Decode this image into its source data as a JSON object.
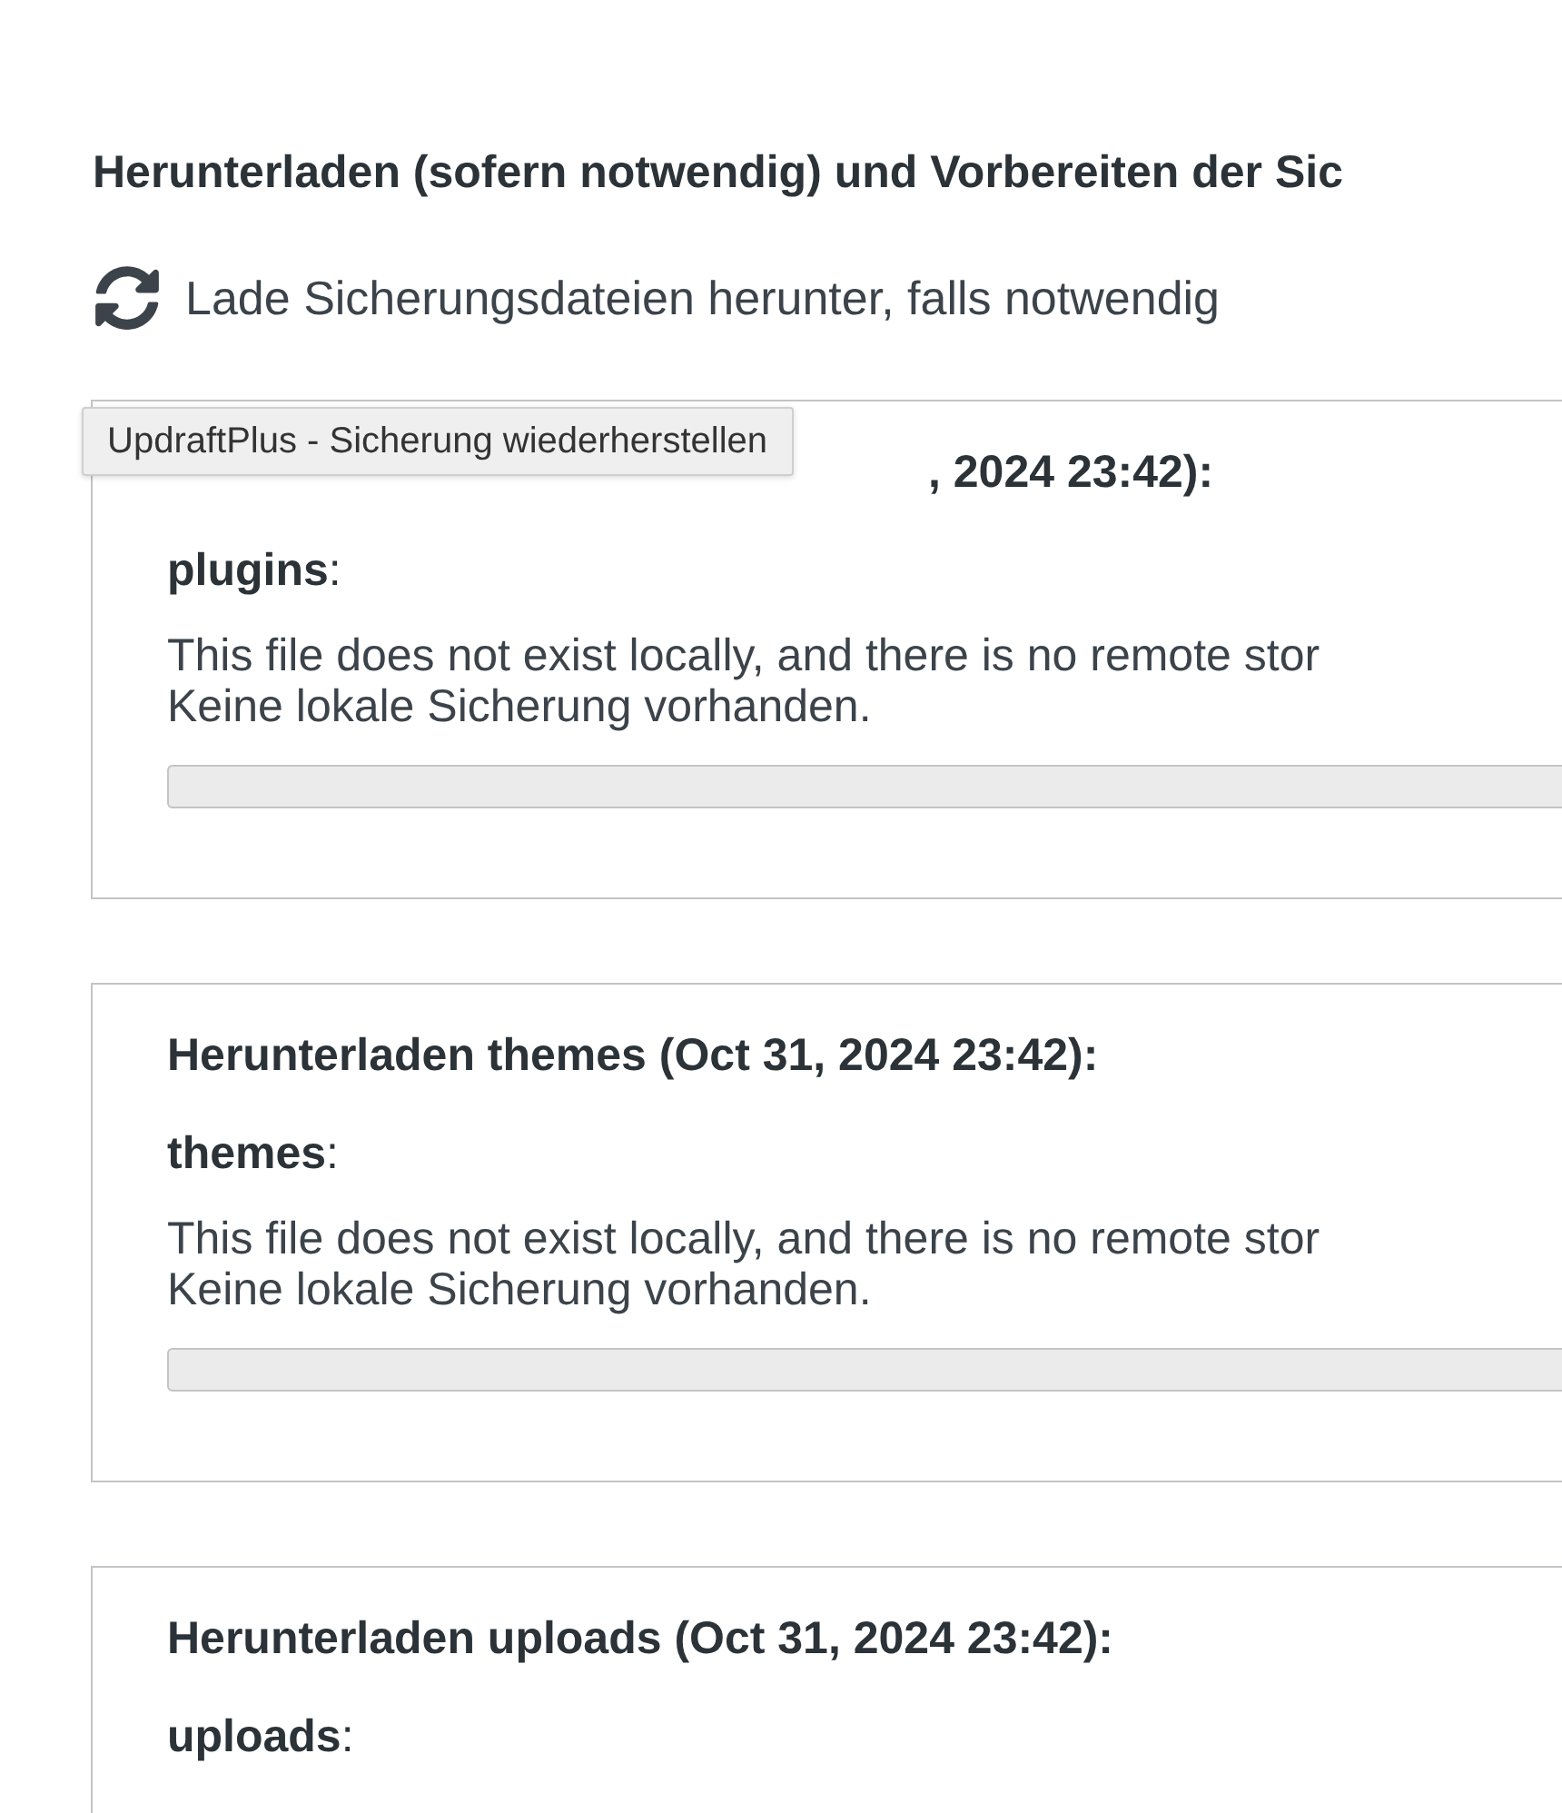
{
  "section_title": "Herunterladen (sofern notwendig) und Vorbereiten der Sic",
  "status": {
    "text": "Lade Sicherungsdateien herunter, falls notwendig"
  },
  "tooltip": {
    "text": "UpdraftPlus - Sicherung wiederherstellen"
  },
  "cards": [
    {
      "partly_covered": true,
      "heading": ", 2024 23:42):",
      "file_label": "**plugins**:",
      "message": "This file does not exist locally, and there is no remote stor",
      "note": "Keine lokale Sicherung vorhanden.",
      "progress": {
        "level": 0
      }
    },
    {
      "partly_covered": false,
      "heading": "Herunterladen themes (Oct 31, 2024 23:42):",
      "file_label": "**themes**:",
      "message": "This file does not exist locally, and there is no remote stor",
      "note": "Keine lokale Sicherung vorhanden.",
      "progress": {
        "level": 0
      }
    },
    {
      "partly_covered": false,
      "heading": "Herunterladen uploads (Oct 31, 2024 23:42):",
      "file_label": "**uploads**:"
    }
  ]
}
